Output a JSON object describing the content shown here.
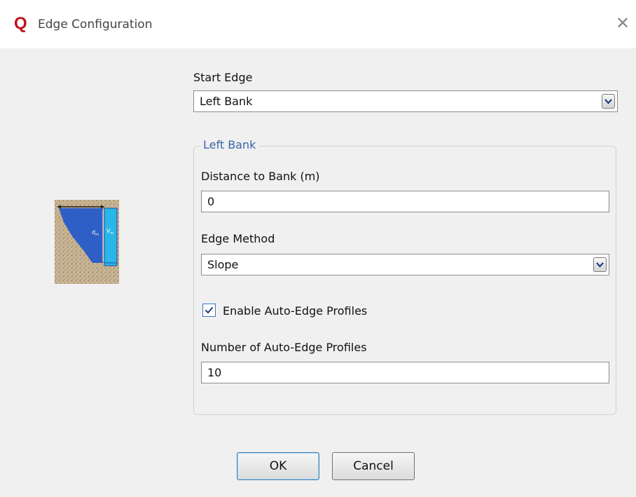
{
  "window": {
    "title": "Edge Configuration",
    "app_icon": "Q",
    "close_glyph": "✕"
  },
  "start_edge": {
    "label": "Start Edge",
    "selected": "Left Bank"
  },
  "group": {
    "title": "Left Bank",
    "distance_label": "Distance to Bank (m)",
    "distance_value": "0",
    "method_label": "Edge Method",
    "method_selected": "Slope",
    "auto_edge_label": "Enable Auto-Edge Profiles",
    "auto_edge_checked": true,
    "num_profiles_label": "Number of Auto-Edge Profiles",
    "num_profiles_value": "10"
  },
  "illustration": {
    "depth_label": "d",
    "depth_sub": "m",
    "velocity_label": "V",
    "velocity_sub": "m"
  },
  "buttons": {
    "ok": "OK",
    "cancel": "Cancel"
  },
  "colors": {
    "accent": "#3b66a8",
    "app_icon": "#c0121c",
    "water": "#2e5fc7",
    "gauge": "#29b6e8"
  }
}
